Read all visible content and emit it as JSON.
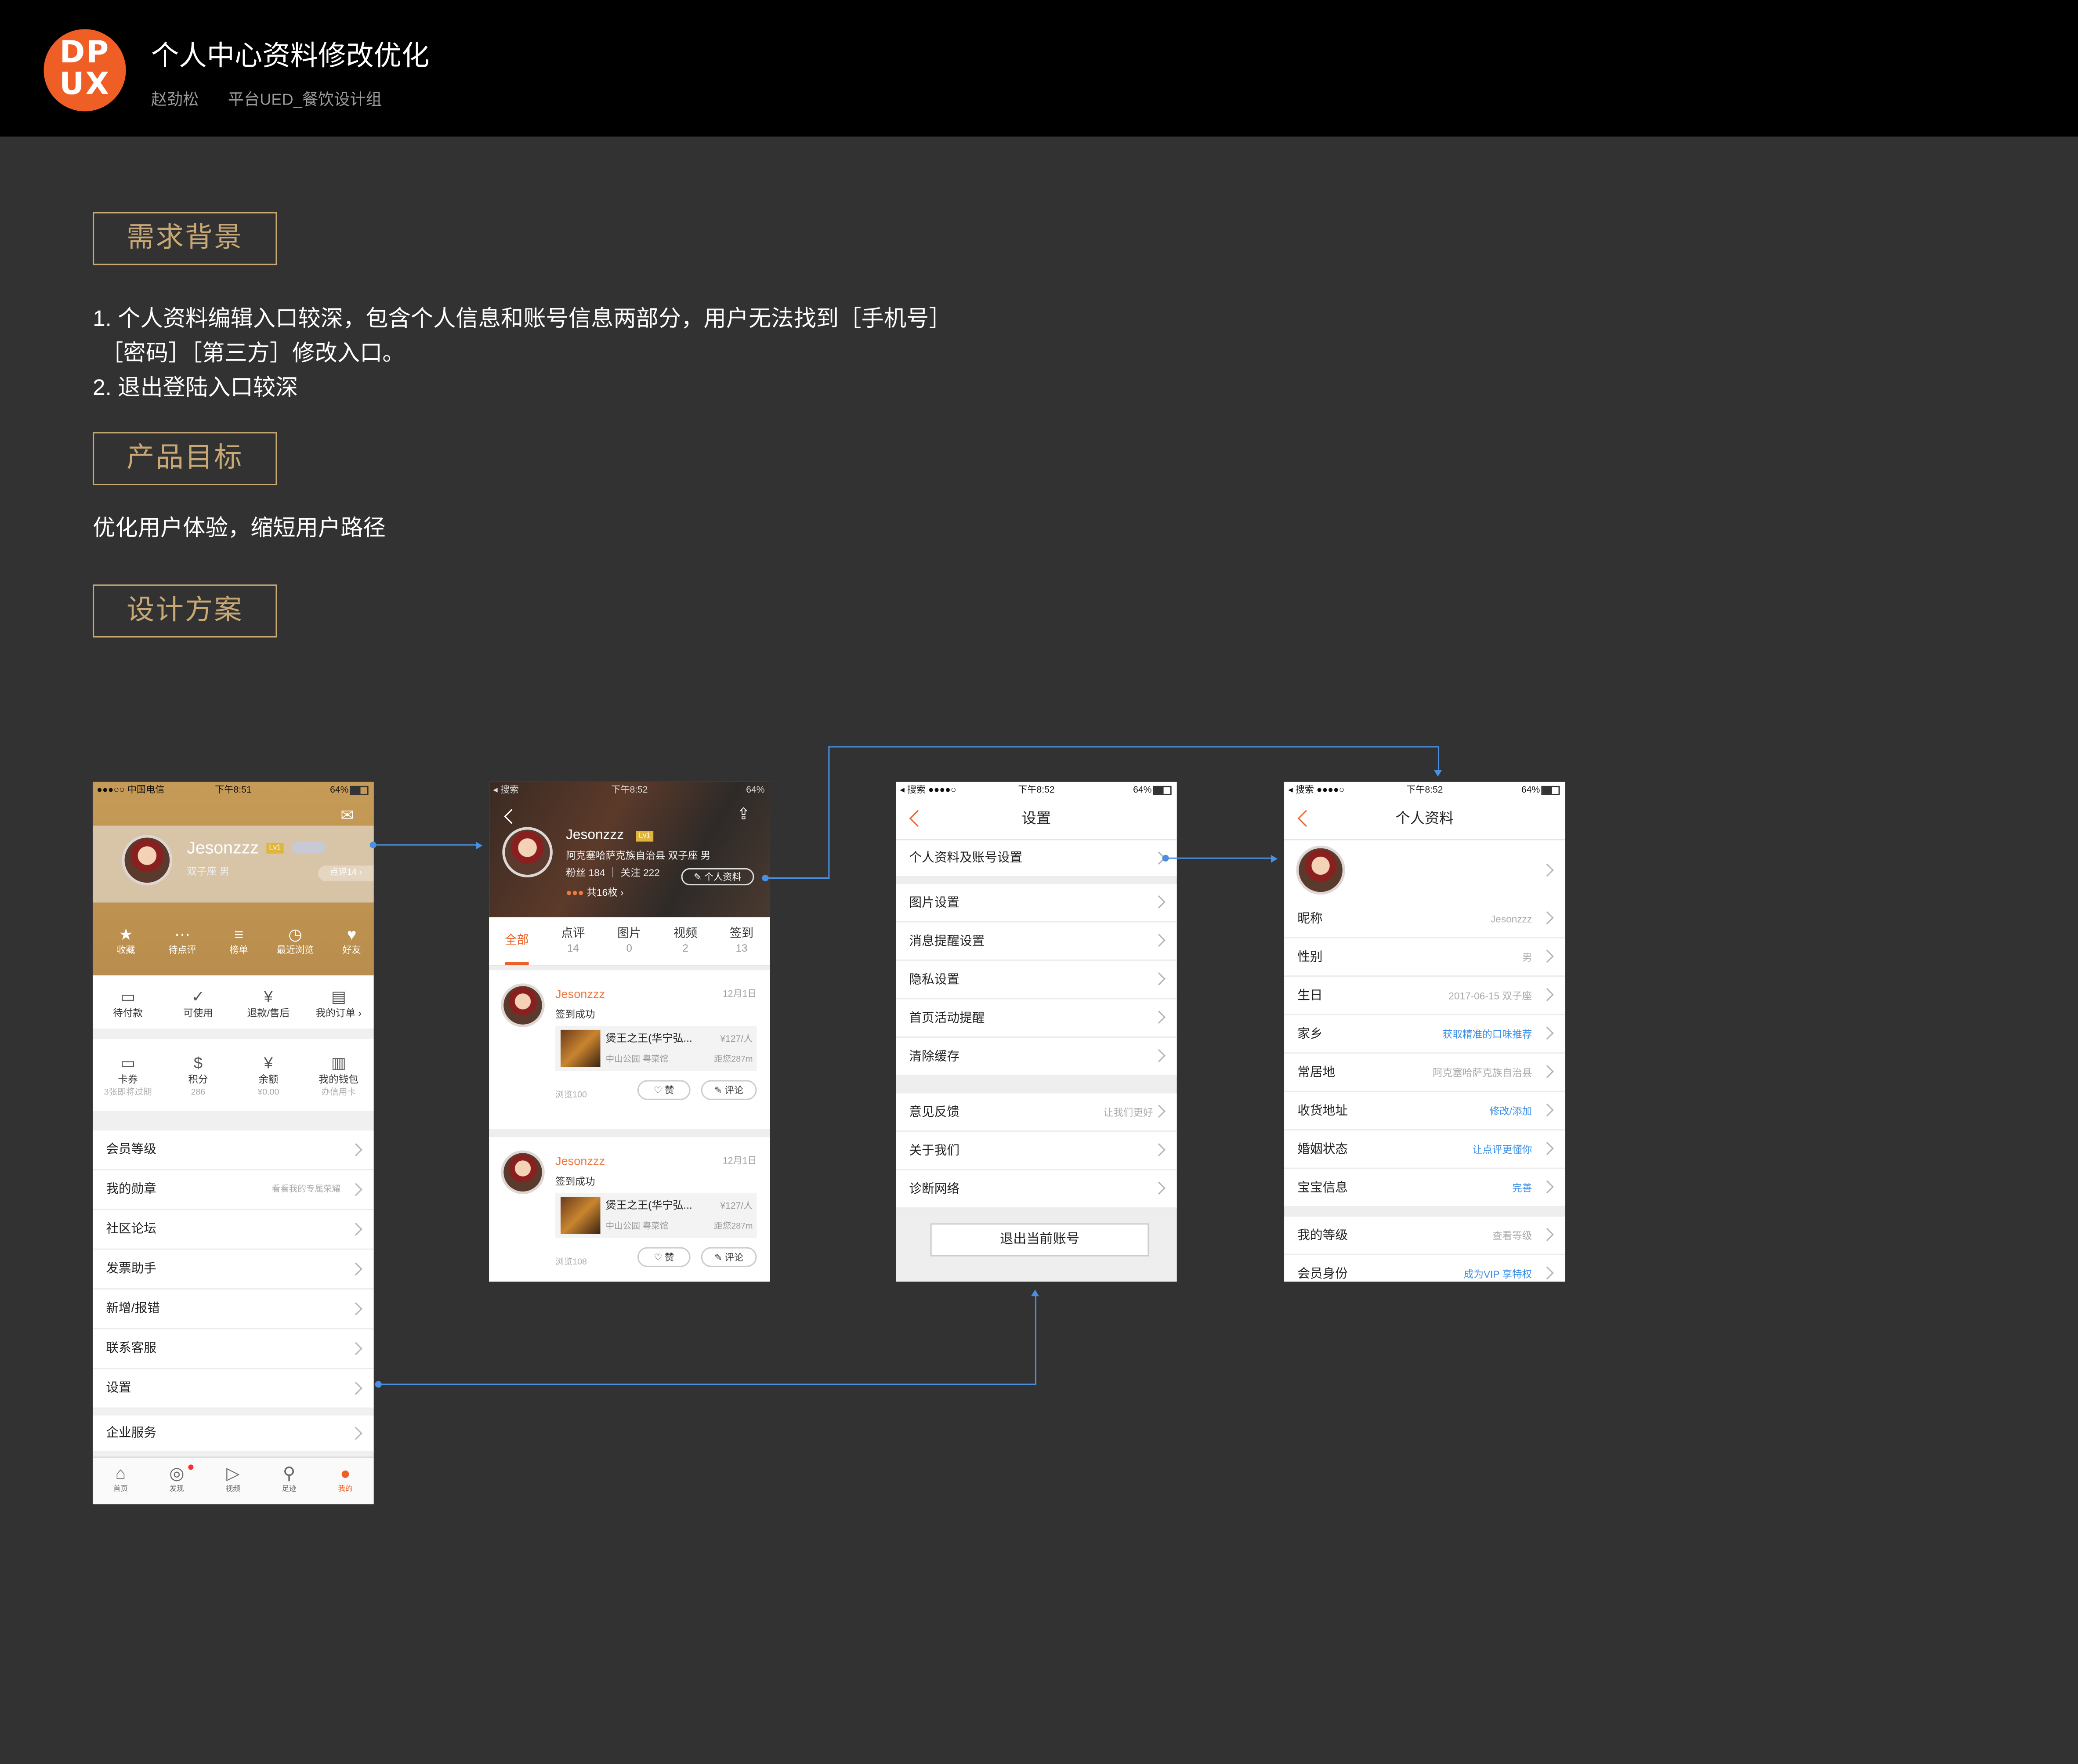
{
  "header": {
    "logo_top": "DP",
    "logo_bottom": "UX",
    "title": "个人中心资料修改优化",
    "author": "赵劲松",
    "team": "平台UED_餐饮设计组"
  },
  "sections": {
    "s1_title": "需求背景",
    "s1_line1": "1. 个人资料编辑入口较深，包含个人信息和账号信息两部分，用户无法找到［手机号］",
    "s1_line2": "［密码］［第三方］修改入口。",
    "s1_line3": "2. 退出登陆入口较深",
    "s2_title": "产品目标",
    "s2_text": "优化用户体验，缩短用户路径",
    "s3_title": "设计方案"
  },
  "screen1": {
    "status": {
      "carrier": "●●●○○ 中国电信",
      "time": "下午8:51",
      "battery": "64%"
    },
    "username": "Jesonzzz",
    "level": "Lv1",
    "sub": "双子座 男",
    "points_tag": "点评14",
    "top_icons": [
      {
        "label": "收藏",
        "icon": "★"
      },
      {
        "label": "待点评",
        "icon": "⋯"
      },
      {
        "label": "榜单",
        "icon": "≡"
      },
      {
        "label": "最近浏览",
        "icon": "◷"
      },
      {
        "label": "好友",
        "icon": "♥"
      }
    ],
    "orders": [
      {
        "label": "待付款",
        "icon": "▭"
      },
      {
        "label": "可使用",
        "icon": "✓"
      },
      {
        "label": "退款/售后",
        "icon": "¥"
      },
      {
        "label": "我的订单 ›",
        "icon": "▤"
      }
    ],
    "wallet": [
      {
        "label": "卡券",
        "sub": "3张即将过期",
        "icon": "▭"
      },
      {
        "label": "积分",
        "sub": "286",
        "icon": "$"
      },
      {
        "label": "余额",
        "sub": "¥0.00",
        "icon": "¥"
      },
      {
        "label": "我的钱包",
        "sub": "办信用卡",
        "icon": "▥"
      }
    ],
    "menu": [
      {
        "label": "会员等级",
        "value": ""
      },
      {
        "label": "我的勋章",
        "value": "看看我的专属荣耀"
      },
      {
        "label": "社区论坛",
        "value": ""
      },
      {
        "label": "发票助手",
        "value": ""
      },
      {
        "label": "新增/报错",
        "value": ""
      },
      {
        "label": "联系客服",
        "value": ""
      },
      {
        "label": "设置",
        "value": ""
      }
    ],
    "enterprise": "企业服务",
    "tabbar": [
      {
        "label": "首页",
        "icon": "⌂"
      },
      {
        "label": "发现",
        "icon": "◎"
      },
      {
        "label": "视频",
        "icon": "▷"
      },
      {
        "label": "足迹",
        "icon": "⚲"
      },
      {
        "label": "我的",
        "icon": "●"
      }
    ]
  },
  "screen2": {
    "status": {
      "left": "◂ 搜索",
      "time": "下午8:52",
      "battery": "64%"
    },
    "username": "Jesonzzz",
    "level": "Lv1",
    "location": "阿克塞哈萨克族自治县 双子座 男",
    "fans": "粉丝 184 ｜ 关注 222",
    "edit_btn": "个人资料",
    "badges": "共16枚 ›",
    "tabs": [
      {
        "label": "全部",
        "count": ""
      },
      {
        "label": "点评",
        "count": "14"
      },
      {
        "label": "图片",
        "count": "0"
      },
      {
        "label": "视频",
        "count": "2"
      },
      {
        "label": "签到",
        "count": "13"
      }
    ],
    "feed": [
      {
        "name": "Jesonzzz",
        "date": "12月1日",
        "action": "签到成功",
        "shop": "煲王之王(华宁弘...",
        "price": "¥127/人",
        "area": "中山公园 粤菜馆",
        "dist": "距您287m",
        "views": "浏览100",
        "like": "赞",
        "comment": "评论"
      },
      {
        "name": "Jesonzzz",
        "date": "12月1日",
        "action": "签到成功",
        "shop": "煲王之王(华宁弘...",
        "price": "¥127/人",
        "area": "中山公园 粤菜馆",
        "dist": "距您287m",
        "views": "浏览108",
        "like": "赞",
        "comment": "评论"
      }
    ]
  },
  "screen3": {
    "status": {
      "left": "◂ 搜索 ●●●●○",
      "time": "下午8:52",
      "battery": "64%"
    },
    "title": "设置",
    "group1": [
      "个人资料及账号设置"
    ],
    "group2": [
      "图片设置",
      "消息提醒设置",
      "隐私设置",
      "首页活动提醒",
      "清除缓存"
    ],
    "group3": [
      {
        "label": "意见反馈",
        "value": "让我们更好"
      },
      {
        "label": "关于我们",
        "value": ""
      },
      {
        "label": "诊断网络",
        "value": ""
      }
    ],
    "logout": "退出当前账号"
  },
  "screen4": {
    "status": {
      "left": "◂ 搜索 ●●●●○",
      "time": "下午8:52",
      "battery": "64%"
    },
    "title": "个人资料",
    "rows": [
      {
        "label": "昵称",
        "value": "Jesonzzz",
        "blue": false
      },
      {
        "label": "性别",
        "value": "男",
        "blue": false
      },
      {
        "label": "生日",
        "value": "2017-06-15 双子座",
        "blue": false
      },
      {
        "label": "家乡",
        "value": "获取精准的口味推荐",
        "blue": true
      },
      {
        "label": "常居地",
        "value": "阿克塞哈萨克族自治县",
        "blue": false
      },
      {
        "label": "收货地址",
        "value": "修改/添加",
        "blue": true
      },
      {
        "label": "婚姻状态",
        "value": "让点评更懂你",
        "blue": true
      },
      {
        "label": "宝宝信息",
        "value": "完善",
        "blue": true
      }
    ],
    "rows2": [
      {
        "label": "我的等级",
        "value": "查看等级",
        "blue": false
      },
      {
        "label": "会员身份",
        "value": "成为VIP 享特权",
        "blue": true
      }
    ]
  },
  "colors": {
    "accent": "#ef5f25",
    "gold": "#c8a875",
    "link": "#4a90e2",
    "bg": "#323232"
  }
}
